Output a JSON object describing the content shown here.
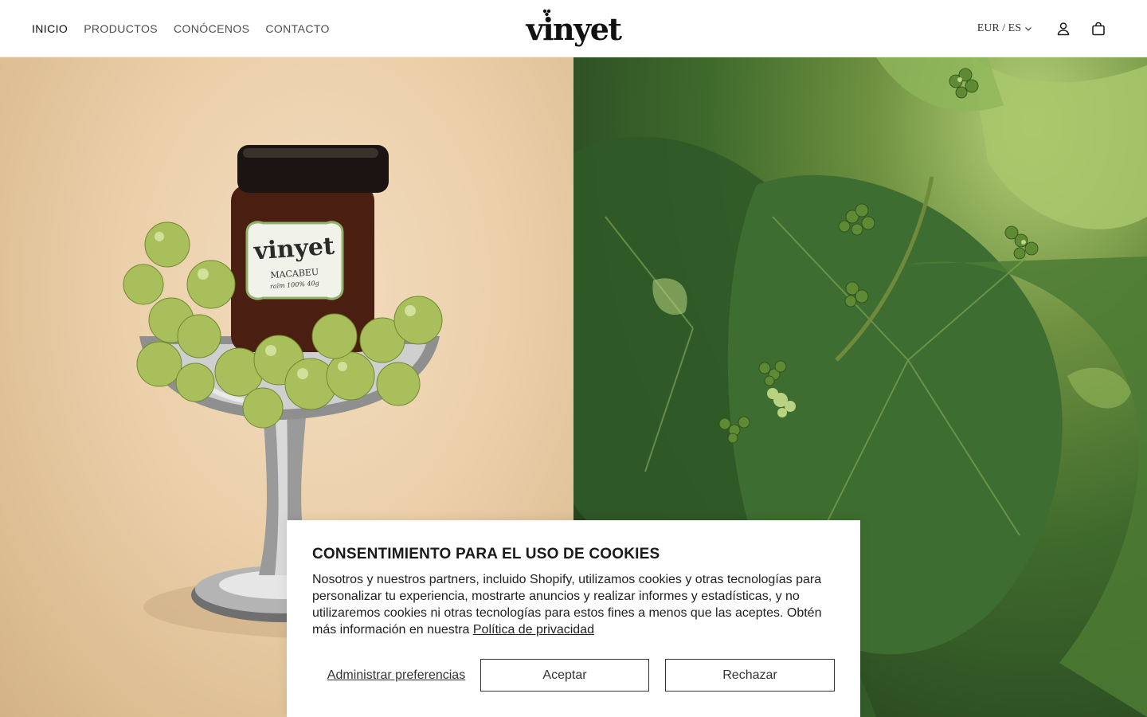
{
  "nav": {
    "items": [
      {
        "label": "INICIO",
        "active": true
      },
      {
        "label": "PRODUCTOS",
        "active": false
      },
      {
        "label": "CONÓCENOS",
        "active": false
      },
      {
        "label": "CONTACTO",
        "active": false
      }
    ]
  },
  "brand": {
    "logo": "vinyet"
  },
  "header": {
    "locale": "EUR / ES",
    "icons": [
      "chevron-down-icon",
      "account-icon",
      "cart-icon"
    ]
  },
  "hero": {
    "left_image": "jar-with-grapes-in-silver-cup",
    "left_jar_label": {
      "brand": "vinyet",
      "variety": "MACABEU",
      "detail": "raïm 100% 40g"
    },
    "right_image": "grapevine-leaves-with-young-grape-clusters",
    "colors": {
      "left_bg": "#ebcfa9",
      "right_bg": "#3f6a2c"
    }
  },
  "cookies": {
    "title": "CONSENTIMIENTO PARA EL USO DE COOKIES",
    "text": "Nosotros y nuestros partners, incluido Shopify, utilizamos cookies y otras tecnologías para personalizar tu experiencia, mostrarte anuncios y realizar informes y estadísticas, y no utilizaremos cookies ni otras tecnologías para estos fines a menos que las aceptes. Obtén más información en nuestra",
    "policy_link": "Política de privacidad",
    "manage_label": "Administrar preferencias",
    "accept_label": "Aceptar",
    "reject_label": "Rechazar"
  }
}
